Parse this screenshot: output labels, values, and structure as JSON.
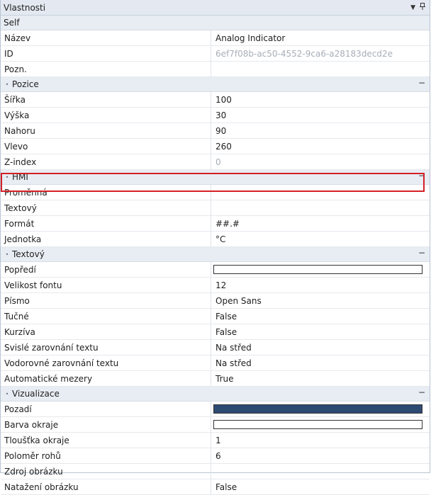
{
  "panel": {
    "title": "Vlastnosti",
    "dropdown_icon": "chevron-down-icon",
    "pin_icon": "pin-icon"
  },
  "sections": [
    {
      "key": "self",
      "label": "Self",
      "rows": [
        {
          "name": "Název",
          "value": "Analog Indicator"
        },
        {
          "name": "ID",
          "value": "6ef7f08b-ac50-4552-9ca6-a28183decd2e",
          "muted": true
        },
        {
          "name": "Pozn.",
          "value": ""
        }
      ]
    },
    {
      "key": "pozice",
      "label": "Pozice",
      "rows": [
        {
          "name": "Šířka",
          "value": "100"
        },
        {
          "name": "Výška",
          "value": "30"
        },
        {
          "name": "Nahoru",
          "value": "90"
        },
        {
          "name": "Vlevo",
          "value": "260"
        },
        {
          "name": "Z-index",
          "value": "0",
          "muted": true
        }
      ]
    },
    {
      "key": "hmi",
      "label": "HMI",
      "rows": [
        {
          "name": "Proměnná",
          "value": "",
          "highlighted": true
        },
        {
          "name": "Textový",
          "value": ""
        },
        {
          "name": "Formát",
          "value": "##.#"
        },
        {
          "name": "Jednotka",
          "value": "°C"
        }
      ]
    },
    {
      "key": "textovy",
      "label": "Textový",
      "rows": [
        {
          "name": "Popředí",
          "value": "",
          "color": "#ffffff"
        },
        {
          "name": "Velikost fontu",
          "value": "12"
        },
        {
          "name": "Písmo",
          "value": "Open Sans"
        },
        {
          "name": "Tučné",
          "value": "False"
        },
        {
          "name": "Kurzíva",
          "value": "False"
        },
        {
          "name": "Svislé zarovnání textu",
          "value": "Na střed"
        },
        {
          "name": "Vodorovné zarovnání textu",
          "value": "Na střed"
        },
        {
          "name": "Automatické mezery",
          "value": "True"
        }
      ]
    },
    {
      "key": "vizualizace",
      "label": "Vizualizace",
      "rows": [
        {
          "name": "Pozadí",
          "value": "",
          "color": "#2d4a73"
        },
        {
          "name": "Barva okraje",
          "value": "",
          "color": "#ffffff"
        },
        {
          "name": "Tloušťka okraje",
          "value": "1"
        },
        {
          "name": "Poloměr rohů",
          "value": "6"
        },
        {
          "name": "Zdroj obrázku",
          "value": ""
        },
        {
          "name": "Natažení obrázku",
          "value": "False"
        }
      ]
    }
  ],
  "colors": {
    "highlight_border": "#d42026",
    "category_bg": "#e8edf3"
  }
}
